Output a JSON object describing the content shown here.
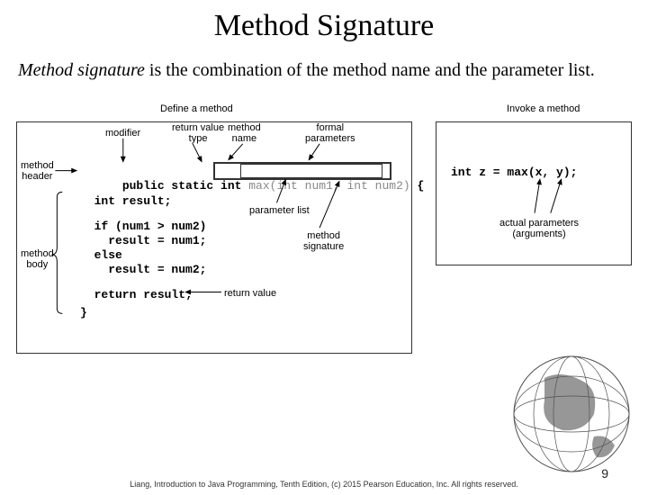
{
  "title": "Method Signature",
  "description_prefix": "Method signature",
  "description_rest": " is the combination of the method name and the parameter list.",
  "labels": {
    "define": "Define a method",
    "invoke": "Invoke a method",
    "modifier": "modifier",
    "return_type": "return value\ntype",
    "method_name": "method\nname",
    "formal_params": "formal\nparameters",
    "method_header": "method\nheader",
    "method_body": "method\nbody",
    "parameter_list": "parameter list",
    "method_signature": "method\nsignature",
    "return_value": "return value",
    "actual_params": "actual parameters\n(arguments)"
  },
  "code": {
    "header_public": "public static int ",
    "header_sig": "max(int num1, int num2)",
    "header_brace": " {",
    "l1": "  int result;",
    "l2": "  if (num1 > num2)",
    "l3": "    result = num1;",
    "l4": "  else",
    "l5": "    result = num2;",
    "l6": "  return result;",
    "l7": "}",
    "invoke": "int z = max(x, y);"
  },
  "footer": "Liang, Introduction to Java Programming, Tenth Edition, (c) 2015 Pearson Education, Inc. All rights reserved.",
  "page": "9"
}
